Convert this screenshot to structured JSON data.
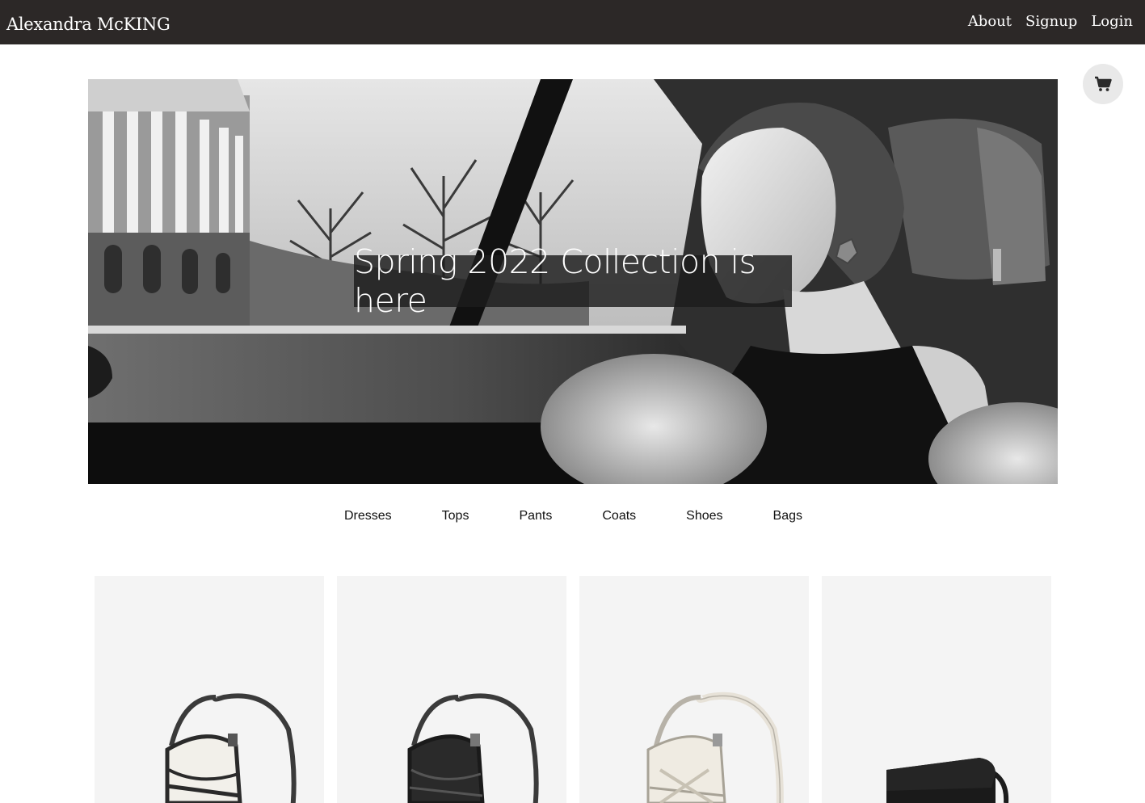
{
  "header": {
    "brand": "Alexandra McKING",
    "nav": [
      {
        "label": "About"
      },
      {
        "label": "Signup"
      },
      {
        "label": "Login"
      }
    ]
  },
  "cart": {
    "icon": "cart-icon"
  },
  "hero": {
    "caption": "Spring 2022 Collection is here"
  },
  "categories": [
    {
      "label": "Dresses"
    },
    {
      "label": "Tops"
    },
    {
      "label": "Pants"
    },
    {
      "label": "Coats"
    },
    {
      "label": "Shoes"
    },
    {
      "label": "Bags"
    }
  ],
  "products": [
    {
      "image": "white-black-shoulder-bag"
    },
    {
      "image": "black-shoulder-bag"
    },
    {
      "image": "ivory-shoulder-bag"
    },
    {
      "image": "black-crossbody-bag"
    }
  ],
  "colors": {
    "header_bg": "#2c2827",
    "card_bg": "#f4f4f4",
    "cart_bg": "#e9e9e9"
  }
}
